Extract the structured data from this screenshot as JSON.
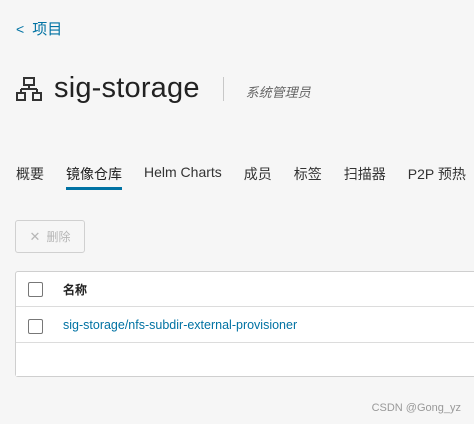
{
  "nav": {
    "back_label": "项目"
  },
  "project": {
    "name": "sig-storage",
    "role": "系统管理员"
  },
  "tabs": [
    {
      "label": "概要"
    },
    {
      "label": "镜像仓库",
      "active": true
    },
    {
      "label": "Helm Charts"
    },
    {
      "label": "成员"
    },
    {
      "label": "标签"
    },
    {
      "label": "扫描器"
    },
    {
      "label": "P2P 预热"
    }
  ],
  "toolbar": {
    "delete_label": "删除"
  },
  "table": {
    "columns": [
      "名称"
    ],
    "rows": [
      {
        "name": "sig-storage/nfs-subdir-external-provisioner"
      }
    ]
  },
  "watermark": "CSDN @Gong_yz",
  "colors": {
    "accent": "#0072a3"
  }
}
